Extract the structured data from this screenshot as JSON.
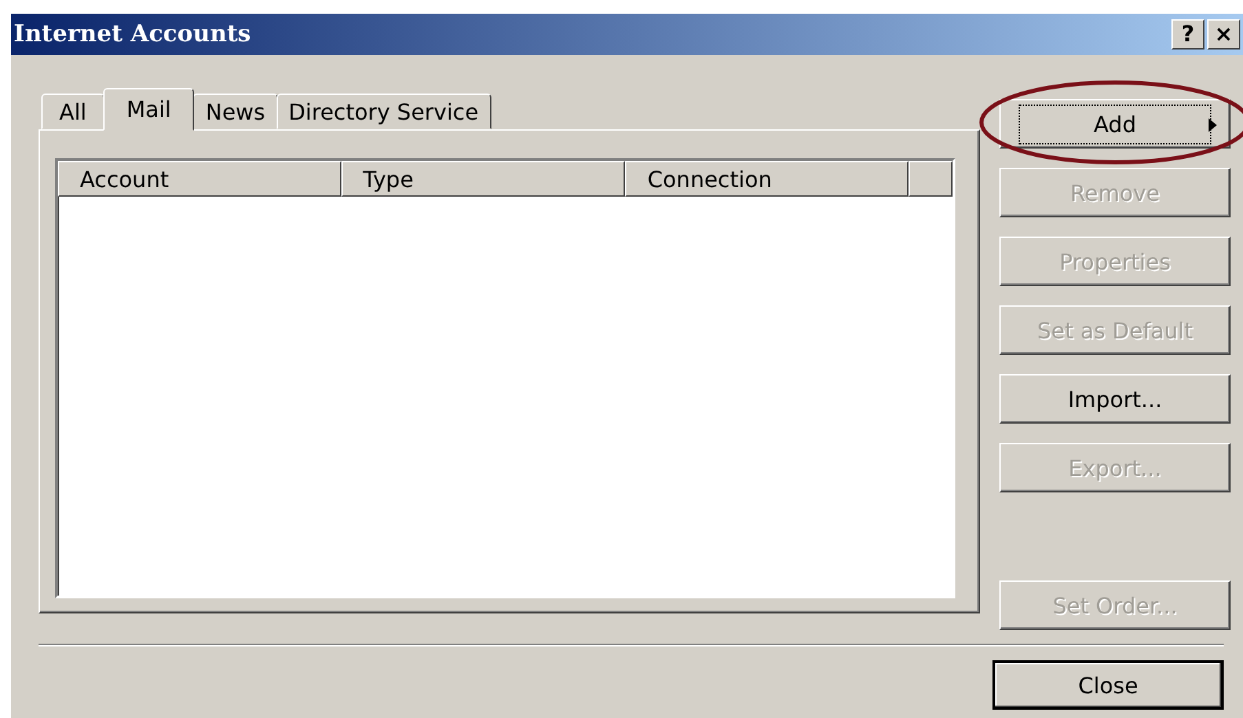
{
  "window": {
    "title": "Internet Accounts",
    "title_buttons": [
      "?",
      "×"
    ]
  },
  "tabs": [
    {
      "label": "All",
      "selected": false
    },
    {
      "label": "Mail",
      "selected": true
    },
    {
      "label": "News",
      "selected": false
    },
    {
      "label": "Directory Service",
      "selected": false
    }
  ],
  "table": {
    "columns": [
      "Account",
      "Type",
      "Connection",
      ""
    ]
  },
  "buttons": [
    {
      "label": "Add",
      "kind": "menu",
      "disabled": false,
      "focused": true
    },
    {
      "label": "Remove",
      "kind": "plain",
      "disabled": true,
      "focused": false
    },
    {
      "label": "Properties",
      "kind": "plain",
      "disabled": true,
      "focused": false
    },
    {
      "label": "Set as Default",
      "kind": "plain",
      "disabled": true,
      "focused": false
    },
    {
      "label": "Import...",
      "kind": "plain",
      "disabled": false,
      "focused": false
    },
    {
      "label": "Export...",
      "kind": "plain",
      "disabled": true,
      "focused": false
    }
  ],
  "set_order_button": {
    "label": "Set Order...",
    "disabled": true
  },
  "close_button": {
    "label": "Close",
    "default": true
  }
}
